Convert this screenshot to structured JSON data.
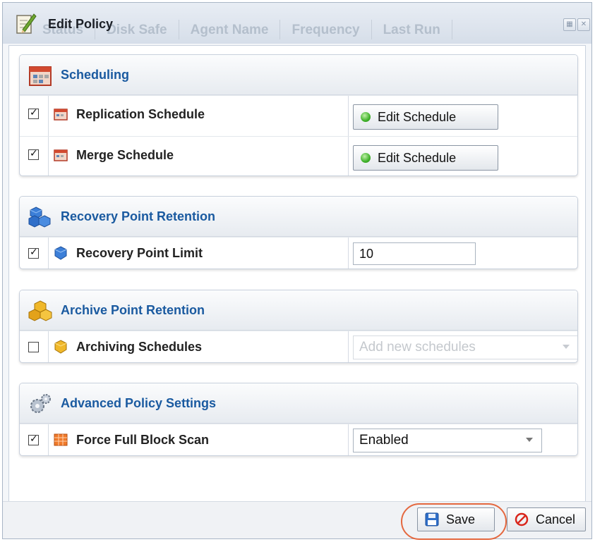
{
  "window": {
    "title": "Edit Policy",
    "background_headers": [
      "Status",
      "Disk Safe",
      "Agent Name",
      "Frequency",
      "Last Run"
    ]
  },
  "sections": {
    "scheduling": {
      "title": "Scheduling",
      "rows": [
        {
          "label": "Replication Schedule",
          "checked": true,
          "button": "Edit Schedule"
        },
        {
          "label": "Merge Schedule",
          "checked": true,
          "button": "Edit Schedule"
        }
      ]
    },
    "recovery": {
      "title": "Recovery Point Retention",
      "row": {
        "label": "Recovery Point Limit",
        "checked": true,
        "value": "10"
      }
    },
    "archive": {
      "title": "Archive Point Retention",
      "row": {
        "label": "Archiving Schedules",
        "checked": false,
        "placeholder": "Add new schedules"
      }
    },
    "advanced": {
      "title": "Advanced Policy Settings",
      "row": {
        "label": "Force Full Block Scan",
        "checked": true,
        "selected": "Enabled"
      }
    }
  },
  "footer": {
    "save_label": "Save",
    "cancel_label": "Cancel"
  },
  "colors": {
    "section_title": "#1a5aa0",
    "highlight": "#e4683f"
  }
}
